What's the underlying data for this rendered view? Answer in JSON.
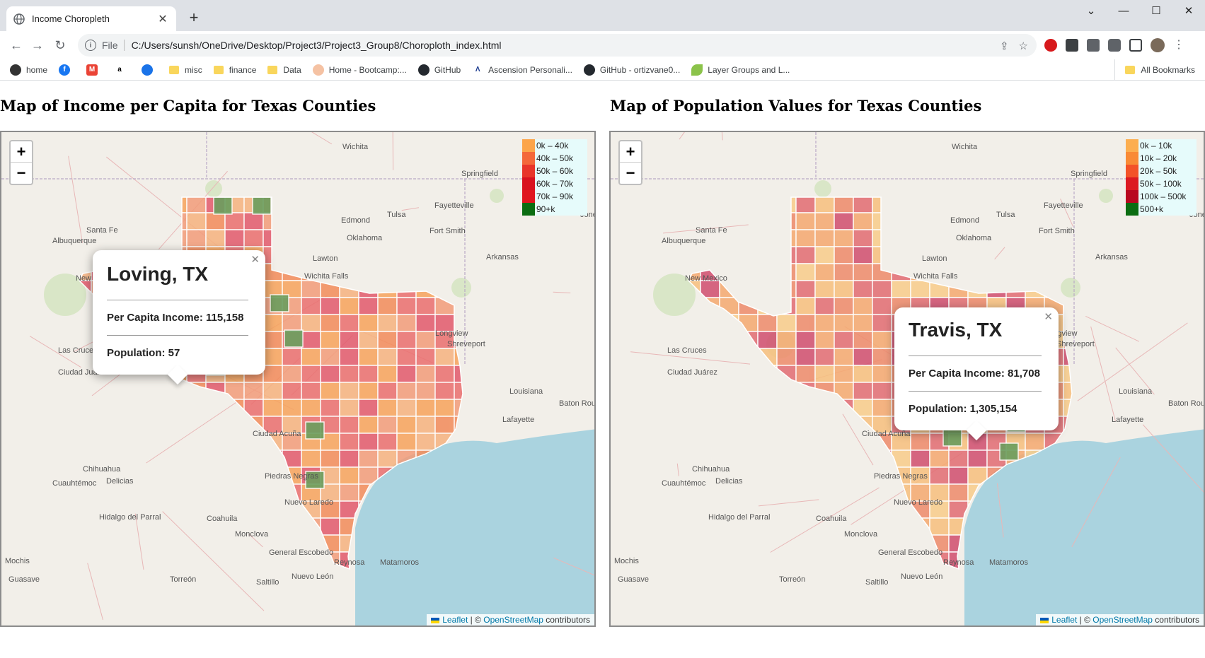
{
  "browser": {
    "tab_title": "Income Choropleth",
    "scheme": "File",
    "url": "C:/Users/sunsh/OneDrive/Desktop/Project3/Project3_Group8/Choroploth_index.html",
    "bookmarks": [
      "home",
      "",
      "",
      "",
      "",
      "misc",
      "finance",
      "Data",
      "Home - Bootcamp:...",
      "GitHub",
      "Ascension Personali...",
      "GitHub - ortizvane0...",
      "Layer Groups and L..."
    ],
    "all_bookmarks": "All Bookmarks"
  },
  "left": {
    "title": "Map of Income per Capita for Texas Counties",
    "legend": [
      {
        "label": "0k – 40k",
        "color": "#fca54a"
      },
      {
        "label": "40k – 50k",
        "color": "#f4683a"
      },
      {
        "label": "50k – 60k",
        "color": "#e8352a"
      },
      {
        "label": "60k – 70k",
        "color": "#d9121f"
      },
      {
        "label": "70k – 90k",
        "color": "#e0161f"
      },
      {
        "label": "90+k",
        "color": "#0b6d12"
      }
    ],
    "popup": {
      "title": "Loving, TX",
      "income": "Per Capita Income: 115,158",
      "population": "Population: 57"
    }
  },
  "right": {
    "title": "Map of Population Values for Texas Counties",
    "legend": [
      {
        "label": "0k – 10k",
        "color": "#fcae4f"
      },
      {
        "label": "10k – 20k",
        "color": "#f98a35"
      },
      {
        "label": "20k – 50k",
        "color": "#f35228"
      },
      {
        "label": "50k – 100k",
        "color": "#dc1a22"
      },
      {
        "label": "100k – 500k",
        "color": "#b8071f"
      },
      {
        "label": "500+k",
        "color": "#0b6d12"
      }
    ],
    "popup": {
      "title": "Travis, TX",
      "income": "Per Capita Income: 81,708",
      "population": "Population: 1,305,154"
    }
  },
  "map_common": {
    "zoom_in": "+",
    "zoom_out": "−",
    "attrib_leaflet": "Leaflet",
    "attrib_sep": " | © ",
    "attrib_osm": "OpenStreetMap",
    "attrib_tail": " contributors",
    "places": [
      "Wichita",
      "Springfield",
      "Edmond",
      "Tulsa",
      "Fayetteville",
      "Santa Fe",
      "Albuquerque",
      "Oklahoma",
      "Fort Smith",
      "Arkansas",
      "Lawton",
      "Wichita Falls",
      "New Mexico",
      "Las Cruces",
      "Ciudad Juárez",
      "Shreveport",
      "Longview",
      "Baton Rouge",
      "Lafayette",
      "Louisiana",
      "Chihuahua",
      "Cuauhtémoc",
      "Delicias",
      "Coahuila",
      "Hidalgo del Parral",
      "Monclova",
      "General Escobedo",
      "Nuevo León",
      "Reynosa",
      "Matamoros",
      "Torreón",
      "Saltillo",
      "Guasave",
      "Mochis",
      "Nuevo Laredo",
      "Piedras Negras",
      "Ciudad Acuña",
      "Jones"
    ]
  }
}
